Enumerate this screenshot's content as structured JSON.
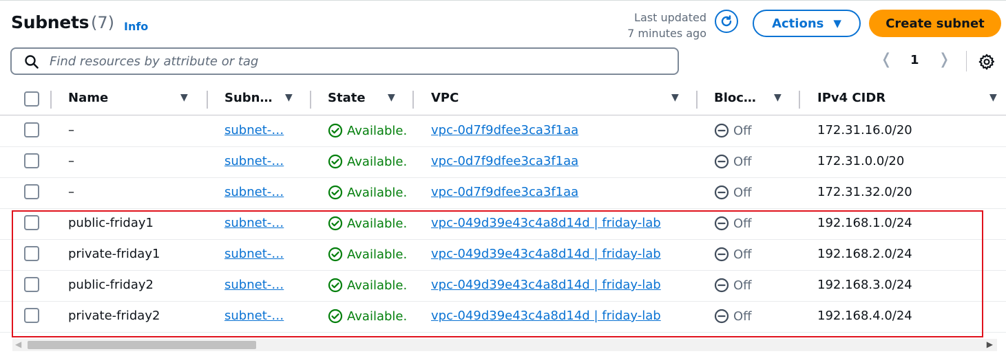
{
  "header": {
    "title": "Subnets",
    "count": "(7)",
    "info_link": "Info",
    "last_updated_line1": "Last updated",
    "last_updated_line2": "7 minutes ago",
    "actions_label": "Actions",
    "create_label": "Create subnet"
  },
  "search": {
    "placeholder": "Find resources by attribute or tag",
    "value": ""
  },
  "pagination": {
    "current_page": "1"
  },
  "columns": {
    "name": "Name",
    "subnet": "Subn…",
    "state": "State",
    "vpc": "VPC",
    "block": "Bloc…",
    "cidr": "IPv4 CIDR"
  },
  "rows": [
    {
      "name": "–",
      "subnet": "subnet-…",
      "state": "Available.",
      "vpc": "vpc-0d7f9dfee3ca3f1aa",
      "block": "Off",
      "cidr": "172.31.16.0/20"
    },
    {
      "name": "–",
      "subnet": "subnet-…",
      "state": "Available.",
      "vpc": "vpc-0d7f9dfee3ca3f1aa",
      "block": "Off",
      "cidr": "172.31.0.0/20"
    },
    {
      "name": "–",
      "subnet": "subnet-…",
      "state": "Available.",
      "vpc": "vpc-0d7f9dfee3ca3f1aa",
      "block": "Off",
      "cidr": "172.31.32.0/20"
    },
    {
      "name": "public-friday1",
      "subnet": "subnet-…",
      "state": "Available.",
      "vpc": "vpc-049d39e43c4a8d14d | friday-lab",
      "block": "Off",
      "cidr": "192.168.1.0/24"
    },
    {
      "name": "private-friday1",
      "subnet": "subnet-…",
      "state": "Available.",
      "vpc": "vpc-049d39e43c4a8d14d | friday-lab",
      "block": "Off",
      "cidr": "192.168.2.0/24"
    },
    {
      "name": "public-friday2",
      "subnet": "subnet-…",
      "state": "Available.",
      "vpc": "vpc-049d39e43c4a8d14d | friday-lab",
      "block": "Off",
      "cidr": "192.168.3.0/24"
    },
    {
      "name": "private-friday2",
      "subnet": "subnet-…",
      "state": "Available.",
      "vpc": "vpc-049d39e43c4a8d14d | friday-lab",
      "block": "Off",
      "cidr": "192.168.4.0/24"
    }
  ],
  "icons": {
    "search": "search-icon",
    "refresh": "refresh-icon",
    "settings": "gear-icon",
    "status": "check-circle-icon",
    "off": "minus-circle-icon",
    "sort": "caret-down-icon"
  },
  "colors": {
    "link": "#0972d3",
    "available": "#037f0c",
    "primary_button": "#ff9900",
    "highlight_box": "#e0121c"
  }
}
